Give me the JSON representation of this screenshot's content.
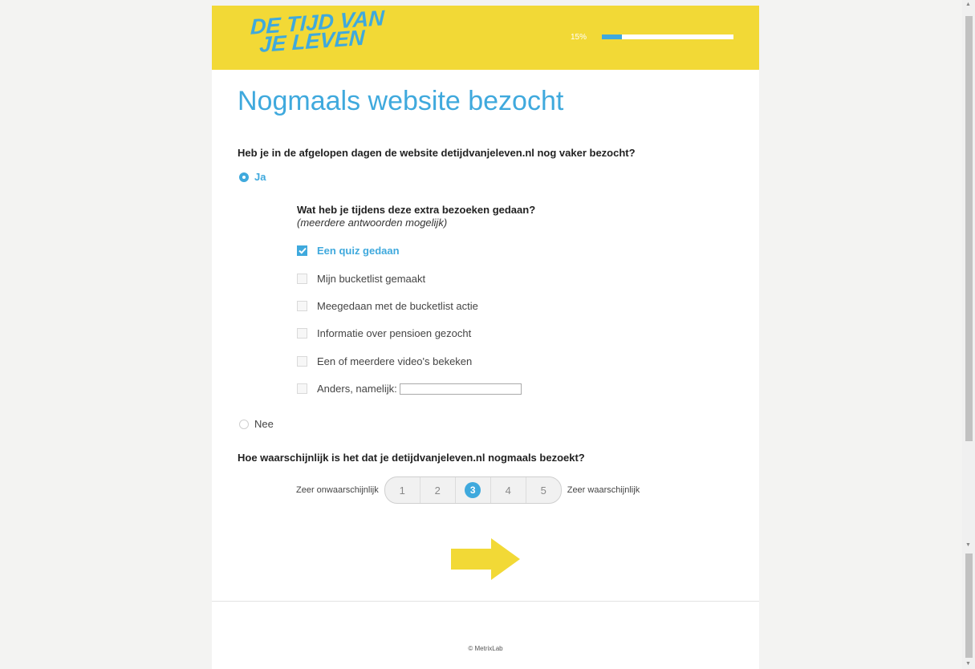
{
  "header": {
    "logo_line1": "DE TIJD VAN",
    "logo_line2": "JE LEVEN",
    "progress_label": "15%",
    "progress_fraction": 0.15
  },
  "page_title": "Nogmaals website bezocht",
  "question1": {
    "text": "Heb je in de afgelopen dagen de website detijdvanjeleven.nl nog vaker bezocht?",
    "option_yes": "Ja",
    "option_no": "Nee",
    "selected": "Ja"
  },
  "subquestion": {
    "text": "Wat heb je tijdens deze extra bezoeken gedaan?",
    "hint": "(meerdere antwoorden mogelijk)",
    "options": [
      {
        "label": "Een quiz gedaan",
        "checked": true
      },
      {
        "label": "Mijn bucketlist gemaakt",
        "checked": false
      },
      {
        "label": "Meegedaan met de bucketlist actie",
        "checked": false
      },
      {
        "label": "Informatie over pensioen gezocht",
        "checked": false
      },
      {
        "label": "Een of meerdere video's bekeken",
        "checked": false
      },
      {
        "label": "Anders, namelijk:",
        "checked": false
      }
    ],
    "other_value": ""
  },
  "question2": {
    "text": "Hoe waarschijnlijk is het dat je detijdvanjeleven.nl nogmaals bezoekt?",
    "low_label": "Zeer onwaarschijnlijk",
    "high_label": "Zeer waarschijnlijk",
    "options": [
      "1",
      "2",
      "3",
      "4",
      "5"
    ],
    "selected": "3"
  },
  "footer": {
    "copyright": "© MetrixLab"
  },
  "colors": {
    "accent": "#3fa9dd",
    "header_yellow": "#f2d936",
    "arrow_yellow": "#f2d936"
  },
  "icons": {
    "next": "arrow-right-icon",
    "check": "checkmark-icon"
  }
}
